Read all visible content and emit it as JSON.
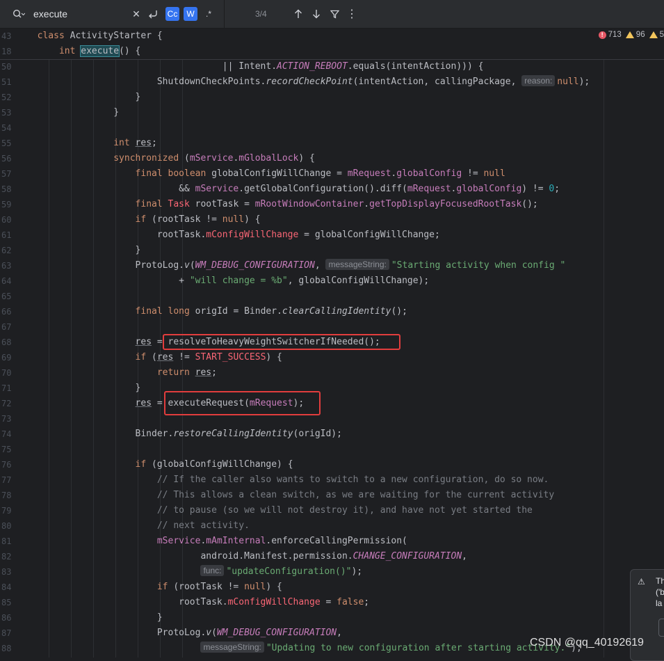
{
  "search": {
    "query": "execute",
    "match_case_label": "Cc",
    "words_label": "W",
    "regex_label": ".*",
    "match_count": "3/4"
  },
  "inspections": {
    "errors": "713",
    "warnings": "96",
    "weak": "5"
  },
  "sticky": [
    {
      "ln": "43",
      "html": "<span class=\"kw\">class</span> ActivityStarter {"
    },
    {
      "ln": "18",
      "html": "    <span class=\"kw\">int</span> <span class=\"hl\">execute</span>() {"
    }
  ],
  "lines": [
    {
      "ln": "50",
      "html": "                    || Intent.<span class=\"cst\">ACTION_REBOOT</span>.equals(intentAction))) {"
    },
    {
      "ln": "51",
      "html": "        ShutdownCheckPoints.<span class=\"it\">recordCheckPoint</span>(intentAction, callingPackage, <span class=\"hint\">reason:</span><span class=\"kw\">null</span>);"
    },
    {
      "ln": "52",
      "html": "    }"
    },
    {
      "ln": "53",
      "html": "}"
    },
    {
      "ln": "54",
      "html": ""
    },
    {
      "ln": "55",
      "html": "<span class=\"kw\">int</span> <span class=\"ul\">res</span>;"
    },
    {
      "ln": "56",
      "html": "<span class=\"kw\">synchronized</span> (<span class=\"fld\">mService</span>.<span class=\"fld\">mGlobalLock</span>) {"
    },
    {
      "ln": "57",
      "html": "    <span class=\"kw\">final boolean</span> globalConfigWillChange = <span class=\"fld\">mRequest</span>.<span class=\"fld\">globalConfig</span> != <span class=\"kw\">null</span>"
    },
    {
      "ln": "58",
      "html": "            &amp;&amp; <span class=\"fld\">mService</span>.getGlobalConfiguration().diff(<span class=\"fld\">mRequest</span>.<span class=\"fld\">globalConfig</span>) != <span class=\"num\">0</span>;"
    },
    {
      "ln": "59",
      "html": "    <span class=\"kw\">final</span> <span class=\"err\">Task</span> rootTask = <span class=\"fld\">mRootWindowContainer</span>.<span class=\"fld\">getTopDisplayFocusedRootTask</span>();"
    },
    {
      "ln": "60",
      "html": "    <span class=\"kw\">if</span> (rootTask != <span class=\"kw\">null</span>) {"
    },
    {
      "ln": "61",
      "html": "        rootTask.<span class=\"err\">mConfigWillChange</span> = globalConfigWillChange;"
    },
    {
      "ln": "62",
      "html": "    }"
    },
    {
      "ln": "63",
      "html": "    ProtoLog.<span class=\"it\">v</span>(<span class=\"cst\">WM_DEBUG_CONFIGURATION</span>, <span class=\"hint\">messageString:</span><span class=\"str\">\"Starting activity when config \"</span>"
    },
    {
      "ln": "64",
      "html": "            + <span class=\"str\">\"will change = %b\"</span>, globalConfigWillChange);"
    },
    {
      "ln": "65",
      "html": ""
    },
    {
      "ln": "66",
      "html": "    <span class=\"kw\">final long</span> origId = Binder.<span class=\"it\">clearCallingIdentity</span>();"
    },
    {
      "ln": "67",
      "html": ""
    },
    {
      "ln": "68",
      "html": "    <span class=\"ul\">res</span> = resolveToHeavyWeightSwitcherIfNeeded();"
    },
    {
      "ln": "69",
      "html": "    <span class=\"kw\">if</span> (<span class=\"ul\">res</span> != <span class=\"err\">START_SUCCESS</span>) {"
    },
    {
      "ln": "70",
      "html": "        <span class=\"kw\">return</span> <span class=\"ul\">res</span>;"
    },
    {
      "ln": "71",
      "html": "    }"
    },
    {
      "ln": "72",
      "html": "    <span class=\"ul\">res</span> = executeRequest(<span class=\"fld\">mRequest</span>);"
    },
    {
      "ln": "73",
      "html": ""
    },
    {
      "ln": "74",
      "html": "    Binder.<span class=\"it\">restoreCallingIdentity</span>(origId);"
    },
    {
      "ln": "75",
      "html": ""
    },
    {
      "ln": "76",
      "html": "    <span class=\"kw\">if</span> (globalConfigWillChange) {"
    },
    {
      "ln": "77",
      "html": "        <span class=\"cmt\">// If the caller also wants to switch to a new configuration, do so now.</span>"
    },
    {
      "ln": "78",
      "html": "        <span class=\"cmt\">// This allows a clean switch, as we are waiting for the current activity</span>"
    },
    {
      "ln": "79",
      "html": "        <span class=\"cmt\">// to pause (so we will not destroy it), and have not yet started the</span>"
    },
    {
      "ln": "80",
      "html": "        <span class=\"cmt\">// next activity.</span>"
    },
    {
      "ln": "81",
      "html": "        <span class=\"fld\">mService</span>.<span class=\"fld\">mAmInternal</span>.enforceCallingPermission("
    },
    {
      "ln": "82",
      "html": "                android.Manifest.permission.<span class=\"cst\">CHANGE_CONFIGURATION</span>,"
    },
    {
      "ln": "83",
      "html": "                <span class=\"hint\">func:</span><span class=\"str\">\"updateConfiguration()\"</span>);"
    },
    {
      "ln": "84",
      "html": "        <span class=\"kw\">if</span> (rootTask != <span class=\"kw\">null</span>) {"
    },
    {
      "ln": "85",
      "html": "            rootTask.<span class=\"err\">mConfigWillChange</span> = <span class=\"kw\">false</span>;"
    },
    {
      "ln": "86",
      "html": "        }"
    },
    {
      "ln": "87",
      "html": "        ProtoLog.<span class=\"it\">v</span>(<span class=\"cst\">WM_DEBUG_CONFIGURATION</span>,"
    },
    {
      "ln": "88",
      "html": "                <span class=\"hint\">messageString:</span><span class=\"str\">\"Updating to new configuration after starting activity.\"</span>);"
    }
  ],
  "notification": {
    "text": "Th ('b la"
  },
  "watermark": "CSDN @qq_40192619"
}
